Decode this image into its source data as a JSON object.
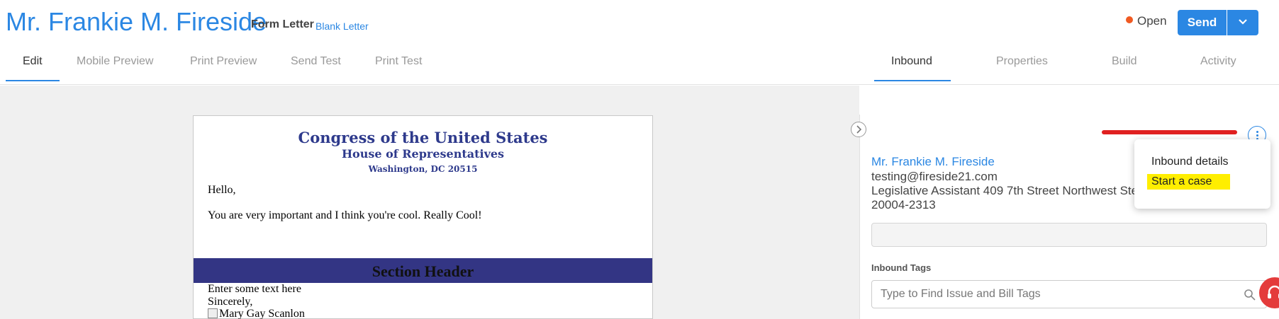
{
  "header": {
    "title": "Mr. Frankie M. Fireside",
    "subtitle": "Form Letter",
    "subtitle_link": "Blank Letter",
    "status": "Open",
    "send_label": "Send"
  },
  "left_tabs": [
    {
      "label": "Edit",
      "active": true
    },
    {
      "label": "Mobile Preview",
      "active": false
    },
    {
      "label": "Print Preview",
      "active": false
    },
    {
      "label": "Send Test",
      "active": false
    },
    {
      "label": "Print Test",
      "active": false
    }
  ],
  "right_tabs": [
    {
      "label": "Inbound",
      "active": true
    },
    {
      "label": "Properties",
      "active": false
    },
    {
      "label": "Build",
      "active": false
    },
    {
      "label": "Activity",
      "active": false
    }
  ],
  "letter": {
    "letterhead_1": "Congress of the United States",
    "letterhead_2": "House of Representatives",
    "letterhead_3": "Washington, DC 20515",
    "greeting": "Hello,",
    "body": "You are very important and I think you're cool. Really Cool!",
    "section_header": "Section Header",
    "section_text": "Enter some text here",
    "closing": "Sincerely,",
    "signature_alt": "Mary Gay Scanlon"
  },
  "panel": {
    "name": "Mr. Frankie M. Fireside",
    "email": "testing@fireside21.com",
    "address_line1": "Legislative Assistant 409 7th Street Northwest Ste 4",
    "address_line2": "20004-2313",
    "tags_label": "Inbound Tags",
    "tags_placeholder": "Type to Find Issue and Bill Tags"
  },
  "menu": {
    "items": [
      "Inbound details",
      "Start a case"
    ]
  },
  "colors": {
    "accent": "#2b87e3",
    "status_dot": "#f05a22",
    "highlight": "#ffee00",
    "section_bar": "#333584"
  }
}
